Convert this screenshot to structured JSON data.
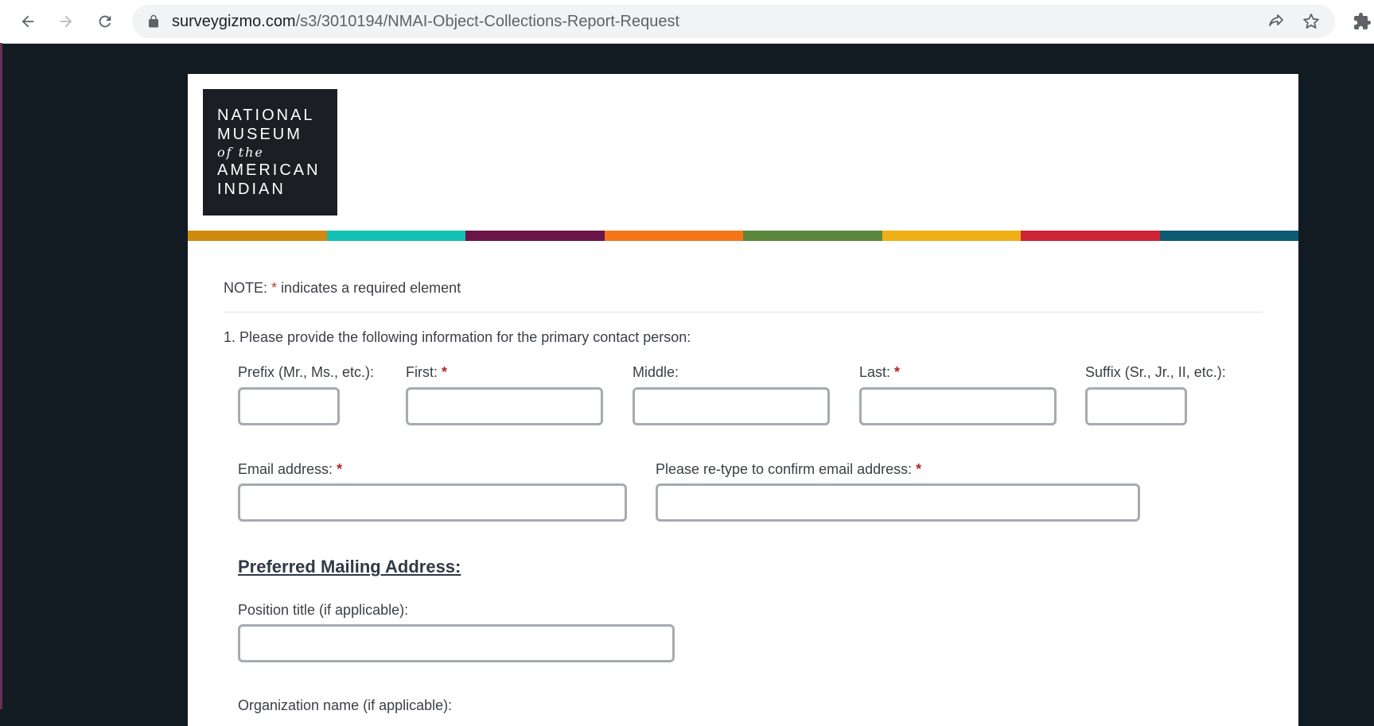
{
  "browser": {
    "url_domain": "surveygizmo.com",
    "url_path": "/s3/3010194/NMAI-Object-Collections-Report-Request"
  },
  "logo": {
    "line1": "NATIONAL",
    "line2": "MUSEUM",
    "line3": "of the",
    "line4": "AMERICAN",
    "line5": "INDIAN"
  },
  "colors": {
    "stripe": [
      "#d08b0f",
      "#13c1b4",
      "#6b1548",
      "#f57619",
      "#5a873b",
      "#eeb014",
      "#cc2536",
      "#0d5b73"
    ],
    "required": "#b3262e",
    "page_background": "#121a22"
  },
  "form": {
    "note_prefix": "NOTE:",
    "note_star": "*",
    "note_text": "indicates a required element",
    "question1": "1. Please provide the following information for the primary contact person:",
    "prefix_label": "Prefix (Mr., Ms., etc.):",
    "first_label": "First:",
    "middle_label": "Middle:",
    "last_label": "Last:",
    "suffix_label": "Suffix (Sr., Jr., II, etc.):",
    "email_label": "Email address:",
    "confirm_email_label": "Please re-type to confirm email address:",
    "required_mark": "*",
    "mailing_heading": "Preferred Mailing Address:",
    "position_label": "Position title (if applicable):",
    "organization_label": "Organization name (if applicable):"
  }
}
